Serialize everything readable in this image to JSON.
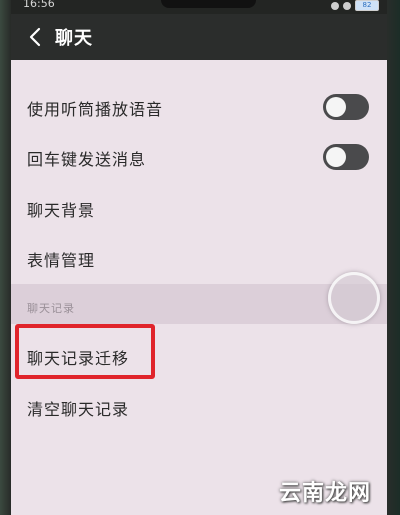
{
  "status_bar": {
    "time": "16:56",
    "battery": "82"
  },
  "header": {
    "title": "聊天",
    "back_icon": "chevron-left-icon"
  },
  "settings": {
    "earpiece_voice": {
      "label": "使用听筒播放语音",
      "enabled": false
    },
    "enter_to_send": {
      "label": "回车键发送消息",
      "enabled": false
    },
    "chat_background": {
      "label": "聊天背景"
    },
    "sticker_management": {
      "label": "表情管理"
    }
  },
  "chat_history_section": {
    "header": "聊天记录",
    "migrate": {
      "label": "聊天记录迁移"
    },
    "clear": {
      "label": "清空聊天记录"
    }
  },
  "annotation": {
    "highlight_color": "#e0242b"
  },
  "watermark": {
    "text": "云南龙网"
  },
  "colors": {
    "app_bar": "#2b2d2c",
    "background": "#ece2e9",
    "toggle_off": "#4a4a4c"
  }
}
